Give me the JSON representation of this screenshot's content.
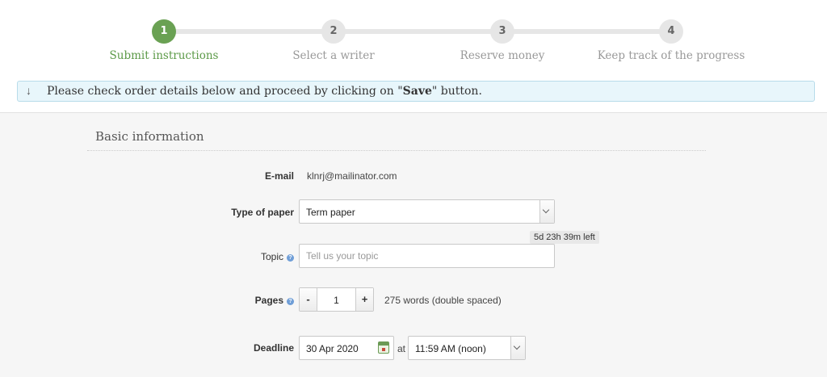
{
  "steps": [
    {
      "number": "1",
      "label": "Submit instructions",
      "active": true
    },
    {
      "number": "2",
      "label": "Select a writer",
      "active": false
    },
    {
      "number": "3",
      "label": "Reserve money",
      "active": false
    },
    {
      "number": "4",
      "label": "Keep track of the progress",
      "active": false
    }
  ],
  "notice": {
    "icon": "arrow-down-icon",
    "prefix": "Please check order details below and proceed by clicking on \"",
    "bold": "Save",
    "suffix": "\" button."
  },
  "section": {
    "title": "Basic information"
  },
  "form": {
    "email": {
      "label": "E-mail",
      "value": "klnrj@mailinator.com"
    },
    "paper_type": {
      "label": "Type of paper",
      "value": "Term paper"
    },
    "topic": {
      "label": "Topic",
      "placeholder": "Tell us your topic",
      "value": ""
    },
    "pages": {
      "label": "Pages",
      "minus": "-",
      "plus": "+",
      "value": "1",
      "words": "275 words (double spaced)"
    },
    "deadline": {
      "label": "Deadline",
      "date": "30 Apr 2020",
      "at": "at",
      "time": "11:59 AM (noon)",
      "time_left": "5d 23h 39m left"
    }
  },
  "colors": {
    "accent": "#6aa153",
    "notice_bg": "#e8f6fb",
    "help_icon": "#6f9ed7"
  }
}
